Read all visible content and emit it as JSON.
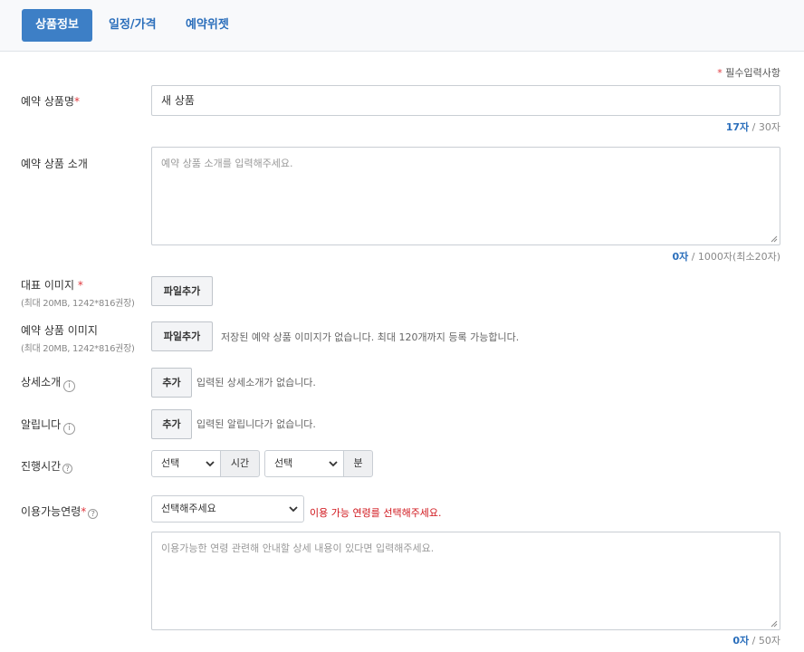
{
  "tabs": [
    {
      "label": "상품정보",
      "active": true
    },
    {
      "label": "일정/가격",
      "active": false
    },
    {
      "label": "예약위젯",
      "active": false
    }
  ],
  "required_note": "필수입력사항",
  "colors": {
    "accent": "#3d7fc6",
    "required": "#e0383e",
    "error": "#d0151b",
    "counter": "#2a6ebb"
  },
  "product_name": {
    "label": "예약 상품명",
    "value": "새 상품",
    "count": "17자",
    "max": " / 30자"
  },
  "product_intro": {
    "label": "예약 상품 소개",
    "placeholder": "예약 상품 소개를 입력해주세요.",
    "count": "0자",
    "max": " / 1000자(최소20자)"
  },
  "main_image": {
    "label": "대표 이미지",
    "sub": "(최대 20MB, 1242*816권장)",
    "button": "파일추가"
  },
  "product_images": {
    "label": "예약 상품 이미지",
    "sub": "(최대 20MB, 1242*816권장)",
    "button": "파일추가",
    "hint": "저장된 예약 상품 이미지가 없습니다. 최대 120개까지 등록 가능합니다."
  },
  "detail": {
    "label": "상세소개",
    "button": "추가",
    "hint": "입력된 상세소개가 없습니다.",
    "icon": "info-icon"
  },
  "notice": {
    "label": "알립니다",
    "button": "추가",
    "hint": "입력된 알립니다가 없습니다.",
    "icon": "info-icon"
  },
  "duration": {
    "label": "진행시간",
    "hour_select": "선택",
    "hour_unit": "시간",
    "minute_select": "선택",
    "minute_unit": "분",
    "icon": "help-icon"
  },
  "age": {
    "label": "이용가능연령",
    "select": "선택해주세요",
    "error": "이용 가능 연령를 선택해주세요.",
    "placeholder": "이용가능한 연령 관련해 안내할 상세 내용이 있다면 입력해주세요.",
    "count": "0자",
    "max": " / 50자",
    "icon": "help-icon"
  }
}
